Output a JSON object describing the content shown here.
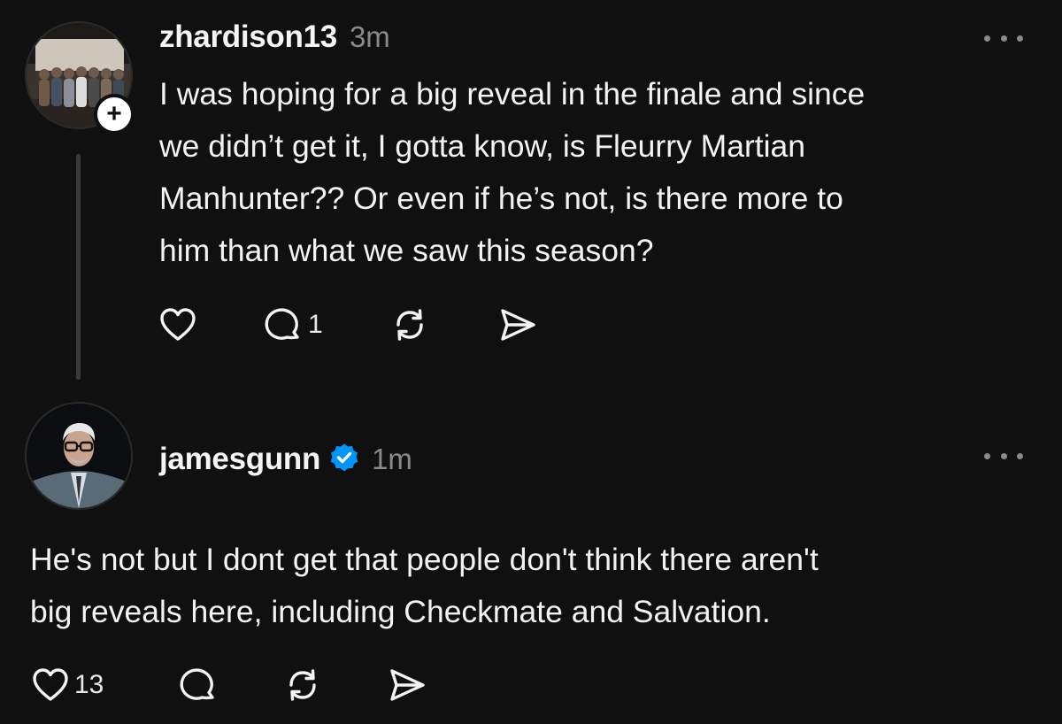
{
  "post1": {
    "username": "zhardison13",
    "time": "3m",
    "lines": [
      "I was hoping for a big reveal in the finale and since",
      "we didn’t get it, I gotta know, is Fleurry Martian",
      "Manhunter?? Or even if he’s not, is there more to",
      "him than what we saw this season?"
    ],
    "reply_count": "1",
    "like_count": "",
    "follow_symbol": "+"
  },
  "post2": {
    "username": "jamesgunn",
    "time": "1m",
    "verified": true,
    "lines": [
      "He's not but I dont get that people don't think there aren't",
      "big reveals here, including Checkmate and Salvation."
    ],
    "like_count": "13",
    "reply_count": ""
  },
  "icons": {
    "like": "heart-icon",
    "reply": "comment-icon",
    "repost": "repost-icon",
    "share": "share-icon",
    "more": "more-icon",
    "verified": "verified-badge-icon"
  },
  "colors": {
    "background": "#101010",
    "text": "#f3f3f3",
    "muted": "#8a8a8a",
    "verified": "#0095f6",
    "thread_line": "#3a3a3a"
  }
}
